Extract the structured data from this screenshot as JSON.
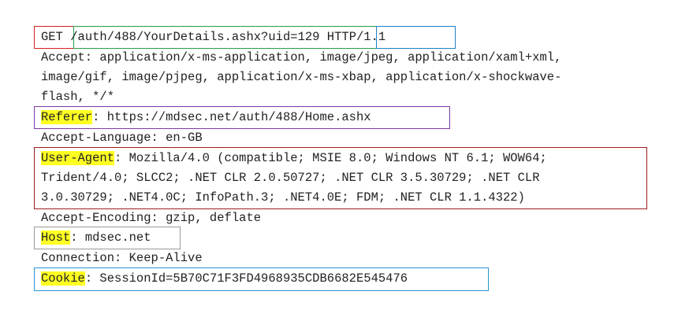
{
  "request_line": {
    "method": "GET",
    "path": "/auth/488/YourDetails.ashx?uid=129",
    "version": "HTTP/1.1"
  },
  "headers": {
    "accept": {
      "line1": "Accept: application/x-ms-application, image/jpeg, application/xaml+xml,",
      "line2": "image/gif, image/pjpeg, application/x-ms-xbap, application/x-shockwave-",
      "line3": "flash, */*"
    },
    "referer": {
      "name": "Referer",
      "value": ": https://mdsec.net/auth/488/Home.ashx"
    },
    "accept_language": "Accept-Language: en-GB",
    "user_agent": {
      "name": "User-Agent",
      "line1_rest": ": Mozilla/4.0 (compatible; MSIE 8.0; Windows NT 6.1; WOW64;",
      "line2": "Trident/4.0; SLCC2; .NET CLR 2.0.50727; .NET CLR 3.5.30729; .NET CLR",
      "line3": "3.0.30729; .NET4.0C; InfoPath.3; .NET4.0E; FDM; .NET CLR 1.1.4322)"
    },
    "accept_encoding": "Accept-Encoding: gzip, deflate",
    "host": {
      "name": "Host",
      "value": ": mdsec.net"
    },
    "connection": "Connection: Keep-Alive",
    "cookie": {
      "name": "Cookie",
      "value": ": SessionId=5B70C71F3FD4968935CDB6682E545476"
    }
  },
  "colors": {
    "method_box": "#d62020",
    "path_box": "#2a9d4a",
    "version_box": "#1f7fc4",
    "referer_box": "#7a3aa8",
    "user_agent_box": "#a11b1b",
    "host_box": "#999999",
    "cookie_box": "#2a93d5",
    "highlight": "#ffff22"
  }
}
